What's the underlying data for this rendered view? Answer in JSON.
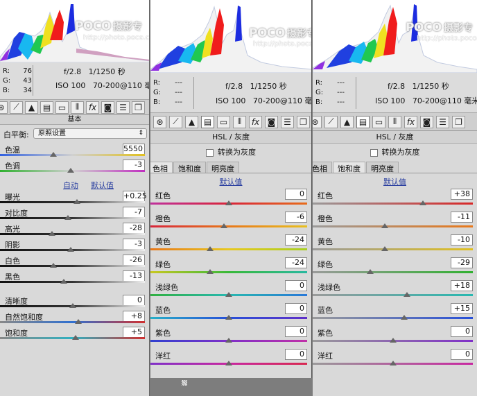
{
  "watermark": {
    "logo": "POCO",
    "tag": "摄影专",
    "url": "http://photo.poco.cn"
  },
  "panels": [
    {
      "rgb": {
        "r_label": "R:",
        "r": "76",
        "g_label": "G:",
        "g": "43",
        "b_label": "B:",
        "b": "34"
      },
      "exif": {
        "aperture": "f/2.8",
        "shutter": "1/1250 秒",
        "iso": "ISO 100",
        "lens": "70-200@110 毫米"
      },
      "section": "基本",
      "wb_label": "白平衡:",
      "wb_value": "原照设置",
      "auto": "自动",
      "default": "默认值",
      "sliders": [
        {
          "label": "色温",
          "value": "5550",
          "pos": 0.37
        },
        {
          "label": "色调",
          "value": "-3",
          "pos": 0.49
        },
        {
          "label": "曝光",
          "value": "+0.25",
          "pos": 0.53
        },
        {
          "label": "对比度",
          "value": "-7",
          "pos": 0.47
        },
        {
          "label": "高光",
          "value": "-28",
          "pos": 0.36
        },
        {
          "label": "阴影",
          "value": "-3",
          "pos": 0.49
        },
        {
          "label": "白色",
          "value": "-26",
          "pos": 0.37
        },
        {
          "label": "黑色",
          "value": "-13",
          "pos": 0.44
        },
        {
          "label": "清晰度",
          "value": "0",
          "pos": 0.5
        },
        {
          "label": "自然饱和度",
          "value": "+8",
          "pos": 0.54
        },
        {
          "label": "饱和度",
          "value": "+5",
          "pos": 0.52
        }
      ]
    },
    {
      "rgb": {
        "r_label": "R:",
        "r": "---",
        "g_label": "G:",
        "g": "---",
        "b_label": "B:",
        "b": "---"
      },
      "exif": {
        "aperture": "f/2.8",
        "shutter": "1/1250 秒",
        "iso": "ISO 100",
        "lens": "70-200@110 毫米"
      },
      "section": "HSL / 灰度",
      "convert": "转换为灰度",
      "tabs": [
        "色相",
        "饱和度",
        "明亮度"
      ],
      "default": "默认值",
      "sliders": [
        {
          "label": "红色",
          "value": "0",
          "pos": 0.5
        },
        {
          "label": "橙色",
          "value": "-6",
          "pos": 0.47
        },
        {
          "label": "黄色",
          "value": "-24",
          "pos": 0.38
        },
        {
          "label": "绿色",
          "value": "-24",
          "pos": 0.38
        },
        {
          "label": "浅绿色",
          "value": "0",
          "pos": 0.5
        },
        {
          "label": "蓝色",
          "value": "0",
          "pos": 0.5
        },
        {
          "label": "紫色",
          "value": "0",
          "pos": 0.5
        },
        {
          "label": "洋红",
          "value": "0",
          "pos": 0.5
        }
      ]
    },
    {
      "rgb": {
        "r_label": "R:",
        "r": "---",
        "g_label": "G:",
        "g": "---",
        "b_label": "B:",
        "b": "---"
      },
      "exif": {
        "aperture": "f/2.8",
        "shutter": "1/1250 秒",
        "iso": "ISO 100",
        "lens": "70-200@110 毫米"
      },
      "section": "HSL / 灰度",
      "convert": "转换为灰度",
      "tabs": [
        "色相",
        "饱和度",
        "明亮度"
      ],
      "default": "默认值",
      "sliders": [
        {
          "label": "红色",
          "value": "+38",
          "pos": 0.69
        },
        {
          "label": "橙色",
          "value": "-11",
          "pos": 0.45
        },
        {
          "label": "黄色",
          "value": "-10",
          "pos": 0.45
        },
        {
          "label": "绿色",
          "value": "-29",
          "pos": 0.36
        },
        {
          "label": "浅绿色",
          "value": "+18",
          "pos": 0.59
        },
        {
          "label": "蓝色",
          "value": "+15",
          "pos": 0.57
        },
        {
          "label": "紫色",
          "value": "0",
          "pos": 0.5
        },
        {
          "label": "洋红",
          "value": "0",
          "pos": 0.5
        }
      ]
    }
  ]
}
